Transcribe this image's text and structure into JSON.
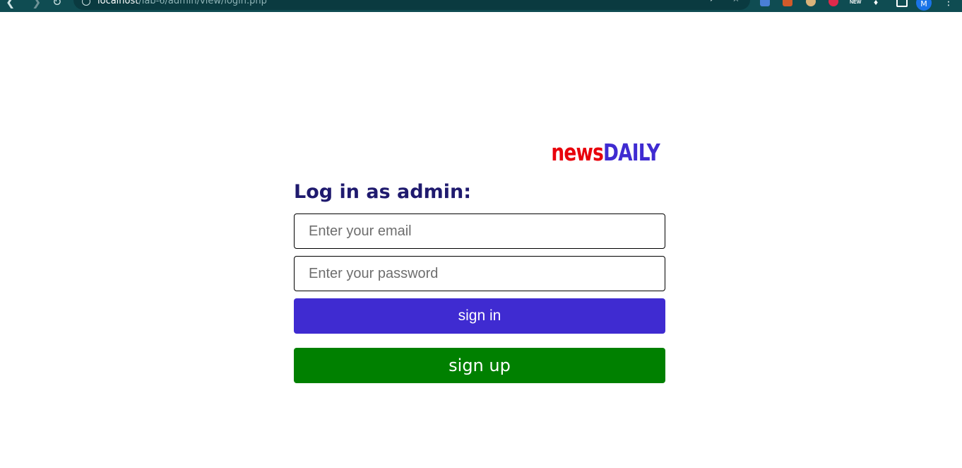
{
  "browser": {
    "url_host": "localhost",
    "url_path": "/lab-6/admin/view/login.php",
    "avatar_letter": "M",
    "extension_badge": "NEW"
  },
  "brand": {
    "part1": "news",
    "part2": "DAILY",
    "part1_color": "#e8000b",
    "part2_color": "#3f2bd1"
  },
  "form": {
    "heading": "Log in as admin:",
    "email_placeholder": "Enter your email",
    "password_placeholder": "Enter your password",
    "signin_label": "sign in",
    "signup_label": "sign up",
    "signin_color": "#3f2bd1",
    "signup_color": "#008000"
  }
}
